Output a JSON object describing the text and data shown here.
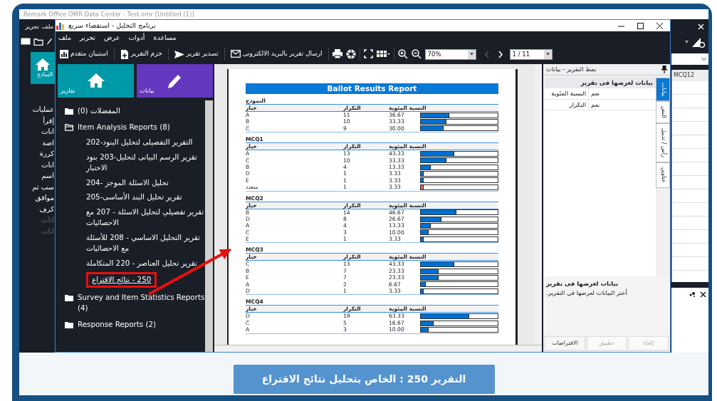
{
  "background_app": {
    "title": "Remark Office OMR Data Center - Test.omr [Untitled (1)]",
    "menu": [
      "ملف",
      "تحرير"
    ],
    "tile": {
      "label": "النماذج"
    },
    "side_items": [
      {
        "label": "عمليات",
        "disabled": false
      },
      {
        "label": "إقرأ",
        "disabled": false
      },
      {
        "label": "انات",
        "disabled": false
      },
      {
        "label": "اصة",
        "disabled": false
      },
      {
        "label": "كررة",
        "disabled": false
      },
      {
        "label": "انات",
        "disabled": false
      },
      {
        "label": "اسم",
        "disabled": false
      },
      {
        "label": "سب ثم",
        "disabled": false
      },
      {
        "label": "موافق",
        "disabled": false
      },
      {
        "label": "كرف",
        "disabled": false
      },
      {
        "label": "انات",
        "disabled": true
      },
      {
        "label": "انات",
        "disabled": true
      }
    ],
    "grid_header": "MCQ12"
  },
  "window": {
    "title": "برنامج التحليل - استقصاء سريع"
  },
  "menu": [
    "مساعدة",
    "أدوات",
    "عرض",
    "تحرير",
    "ملف"
  ],
  "toolbar": {
    "actions": [
      {
        "label": "ارسال تقرير بالبريد الالكترونى"
      },
      {
        "label": "تصدير تقرير"
      },
      {
        "label": "جزم التقرير"
      },
      {
        "label": "استبيان متقدم"
      }
    ],
    "zoom": "70%",
    "pager": {
      "value": "1 / 11",
      "prev_disabled": true,
      "next_disabled": false
    }
  },
  "sidebar": {
    "tiles": [
      {
        "label": "بيانات",
        "color": "#6438be"
      },
      {
        "label": "تقارير",
        "color": "#0099a8"
      }
    ],
    "tree": [
      {
        "label": "المفضلات (0)",
        "expanded": false
      },
      {
        "label": "Item Analysis Reports (8)",
        "expanded": true,
        "children": [
          {
            "label": "التقرير التفصيلى لتحليل البنود-202",
            "selected": false
          },
          {
            "label": "تقرير الرسم البيانى لتحليل-203 بنود الاختبار",
            "selected": false
          },
          {
            "label": "تحليل الاسئلة الموجز -204",
            "selected": false
          },
          {
            "label": "تقرير تحليل البند الأساسى-205",
            "selected": false
          },
          {
            "label": "تقرير تفصيلي لتحليل الاسئلة - 207 مع الاحصائيات",
            "selected": false
          },
          {
            "label": "تقرير التحليل الاساسي - 208 للأسئلة مع الاحصائيات",
            "selected": false
          },
          {
            "label": "تقرير تحليل العناصر - 220 المتكاملة",
            "selected": false
          },
          {
            "label": "250 - نتائج الاقتراع",
            "selected": true
          }
        ]
      },
      {
        "label": "Survey and Item Statistics Reports (4)",
        "expanded": false
      },
      {
        "label": "Response Reports (2)",
        "expanded": false
      }
    ]
  },
  "report": {
    "title": "Ballot Results Report",
    "sections": [
      {
        "title": "النموذج",
        "columns": [
          "النسبة المئوية",
          "التكرار",
          "خيار"
        ],
        "rows": [
          {
            "option": "A",
            "count": "11",
            "percent": "36.67",
            "level": 0.3667,
            "color": "#0070d0"
          },
          {
            "option": "B",
            "count": "10",
            "percent": "33.33",
            "level": 0.3333,
            "color": "#0070d0"
          },
          {
            "option": "C",
            "count": "9",
            "percent": "30.00",
            "level": 0.3,
            "color": "#0070d0"
          }
        ]
      },
      {
        "title": "MCQ1",
        "columns": [
          "النسبة المئوية",
          "التكرار",
          "خيار"
        ],
        "rows": [
          {
            "option": "A",
            "count": "13",
            "percent": "43.33",
            "level": 0.4333,
            "color": "#0070d0"
          },
          {
            "option": "C",
            "count": "10",
            "percent": "33.33",
            "level": 0.3333,
            "color": "#0070d0"
          },
          {
            "option": "B",
            "count": "4",
            "percent": "13.33",
            "level": 0.1333,
            "color": "#0070d0"
          },
          {
            "option": "D",
            "count": "1",
            "percent": "3.33",
            "level": 0.0333,
            "color": "#0070d0"
          },
          {
            "option": "E",
            "count": "1",
            "percent": "3.33",
            "level": 0.0333,
            "color": "#0070d0"
          },
          {
            "option": "متعدد",
            "count": "1",
            "percent": "3.33",
            "level": 0.0333,
            "color": "#e8606a"
          }
        ]
      },
      {
        "title": "MCQ2",
        "columns": [
          "النسبة المئوية",
          "التكرار",
          "خيار"
        ],
        "rows": [
          {
            "option": "B",
            "count": "14",
            "percent": "46.67",
            "level": 0.4667,
            "color": "#0070d0"
          },
          {
            "option": "D",
            "count": "8",
            "percent": "26.67",
            "level": 0.2667,
            "color": "#0070d0"
          },
          {
            "option": "A",
            "count": "4",
            "percent": "13.33",
            "level": 0.1333,
            "color": "#0070d0"
          },
          {
            "option": "C",
            "count": "3",
            "percent": "10.00",
            "level": 0.1,
            "color": "#0070d0"
          },
          {
            "option": "E",
            "count": "1",
            "percent": "3.33",
            "level": 0.0333,
            "color": "#0070d0"
          }
        ]
      },
      {
        "title": "MCQ3",
        "columns": [
          "النسبة المئوية",
          "التكرار",
          "خيار"
        ],
        "rows": [
          {
            "option": "C",
            "count": "13",
            "percent": "43.33",
            "level": 0.4333,
            "color": "#0070d0"
          },
          {
            "option": "B",
            "count": "7",
            "percent": "23.33",
            "level": 0.2333,
            "color": "#0070d0"
          },
          {
            "option": "E",
            "count": "7",
            "percent": "23.33",
            "level": 0.2333,
            "color": "#0070d0"
          },
          {
            "option": "A",
            "count": "2",
            "percent": "6.67",
            "level": 0.0667,
            "color": "#0070d0"
          },
          {
            "option": "D",
            "count": "1",
            "percent": "3.33",
            "level": 0.0333,
            "color": "#0070d0"
          }
        ]
      },
      {
        "title": "MCQ4",
        "columns": [
          "النسبة المئوية",
          "التكرار",
          "خيار"
        ],
        "rows": [
          {
            "option": "D",
            "count": "19",
            "percent": "63.33",
            "level": 0.6333,
            "color": "#0070d0"
          },
          {
            "option": "C",
            "count": "5",
            "percent": "16.67",
            "level": 0.1667,
            "color": "#0070d0"
          },
          {
            "option": "A",
            "count": "3",
            "percent": "10.00",
            "level": 0.1,
            "color": "#0070d0"
          }
        ]
      }
    ]
  },
  "properties_panel": {
    "title": "نمط التقرير - بيانات",
    "category": "بيانات لعرضها فى تقرير",
    "rows": [
      {
        "name": "النسبة المئوية",
        "value": "نعم"
      },
      {
        "name": "التكرار",
        "value": "نعم"
      }
    ],
    "tabs": [
      {
        "label": "بيانات",
        "selected": true
      },
      {
        "label": "النص",
        "selected": false
      },
      {
        "label": "رأس / تذييل",
        "selected": false
      },
      {
        "label": "عناوين",
        "selected": false
      }
    ],
    "description": {
      "title": "بيانات لعرضها فى تقرير",
      "text": "أختر البيانات لعرضها في التقرير."
    },
    "buttons": [
      {
        "label": "إلغاء",
        "disabled": true
      },
      {
        "label": "تطبيق",
        "disabled": true
      },
      {
        "label": "الافتراضات",
        "disabled": false
      }
    ]
  },
  "caption": "التقرير 250 : الخاص بتحليل نتائج الاقتراع"
}
